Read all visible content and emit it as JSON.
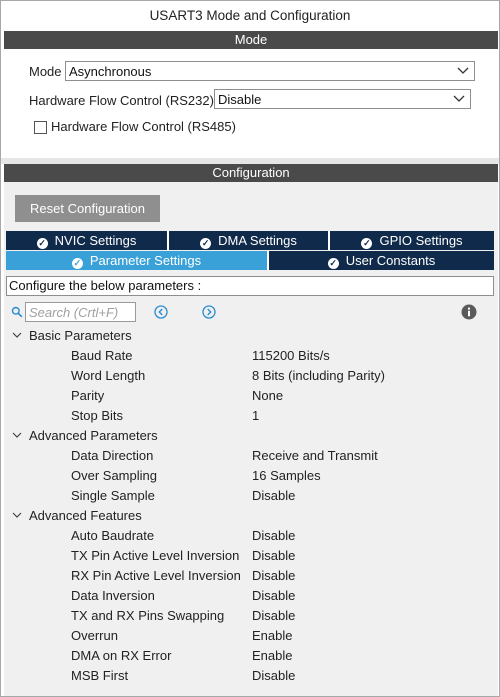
{
  "window": {
    "title": "USART3 Mode and Configuration"
  },
  "mode_section": {
    "header": "Mode",
    "mode_label": "Mode",
    "mode_value": "Asynchronous",
    "hwfc232_label": "Hardware Flow Control (RS232)",
    "hwfc232_value": "Disable",
    "hwfc485_label": "Hardware Flow Control (RS485)",
    "hwfc485_checked": false
  },
  "config_section": {
    "header": "Configuration",
    "reset_label": "Reset Configuration",
    "tabs_row1": [
      "NVIC Settings",
      "DMA Settings",
      "GPIO Settings"
    ],
    "tabs_row2": [
      "Parameter Settings",
      "User Constants"
    ],
    "active_tab": "Parameter Settings",
    "hint": "Configure the below parameters :",
    "search_placeholder": "Search (Crtl+F)"
  },
  "groups": [
    {
      "name": "Basic Parameters",
      "params": [
        {
          "name": "Baud Rate",
          "value": "115200 Bits/s"
        },
        {
          "name": "Word Length",
          "value": "8 Bits (including Parity)"
        },
        {
          "name": "Parity",
          "value": "None"
        },
        {
          "name": "Stop Bits",
          "value": "1"
        }
      ]
    },
    {
      "name": "Advanced Parameters",
      "params": [
        {
          "name": "Data Direction",
          "value": "Receive and Transmit"
        },
        {
          "name": "Over Sampling",
          "value": "16 Samples"
        },
        {
          "name": "Single Sample",
          "value": "Disable"
        }
      ]
    },
    {
      "name": "Advanced Features",
      "params": [
        {
          "name": "Auto Baudrate",
          "value": "Disable"
        },
        {
          "name": "TX Pin Active Level Inversion",
          "value": "Disable"
        },
        {
          "name": "RX Pin Active Level Inversion",
          "value": "Disable"
        },
        {
          "name": "Data Inversion",
          "value": "Disable"
        },
        {
          "name": "TX and RX Pins Swapping",
          "value": "Disable"
        },
        {
          "name": "Overrun",
          "value": "Enable"
        },
        {
          "name": "DMA on RX Error",
          "value": "Enable"
        },
        {
          "name": "MSB First",
          "value": "Disable"
        }
      ]
    }
  ]
}
